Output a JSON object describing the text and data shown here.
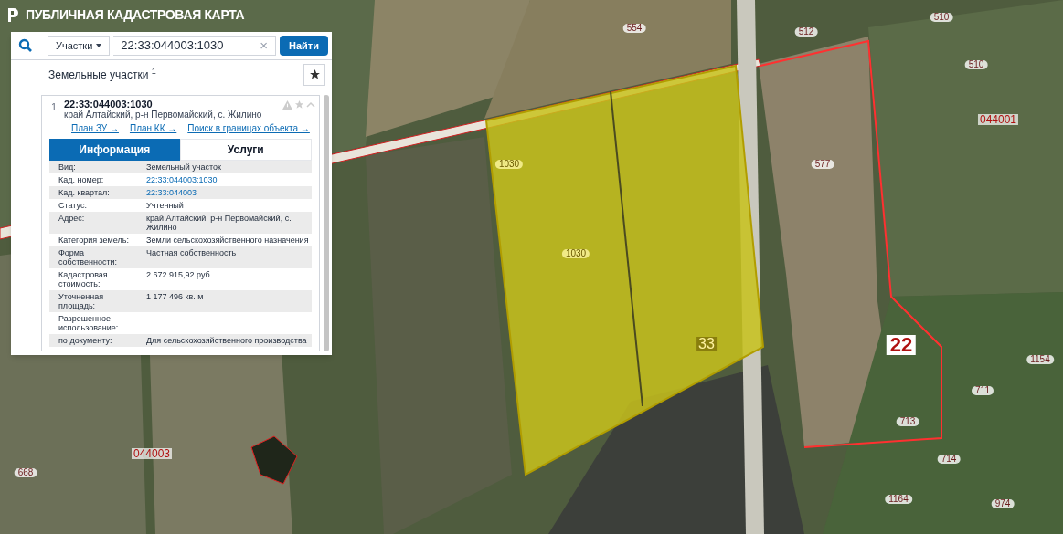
{
  "header": {
    "title": "ПУБЛИЧНАЯ КАДАСТРОВАЯ КАРТА"
  },
  "search": {
    "type_select": "Участки",
    "value": "22:33:044003:1030",
    "clear": "×",
    "button": "Найти"
  },
  "results": {
    "title": "Земельные участки $^{1}$",
    "items": [
      {
        "index": "1.",
        "number": "22:33:044003:1030",
        "address": "край Алтайский, р-н Первомайский, с. Жилино",
        "expanded": true,
        "links": [
          "План ЗУ →",
          "План КК →",
          "Поиск в границах объекта →"
        ],
        "tabs": [
          {
            "label": "Информация",
            "selected": true
          },
          {
            "label": "Услуги",
            "selected": false
          }
        ],
        "fields": [
          {
            "label": "Вид:",
            "value": "Земельный участок",
            "kind": "text"
          },
          {
            "label": "Кад. номер:",
            "value": "22:33:044003:1030",
            "kind": "link"
          },
          {
            "label": "Кад. квартал:",
            "value": "22:33:044003",
            "kind": "link"
          },
          {
            "label": "Статус:",
            "value": "Учтенный",
            "kind": "text"
          },
          {
            "label": "Адрес:",
            "value": "край Алтайский, р-н Первомайский, с. Жилино",
            "kind": "text"
          },
          {
            "label": "Категория земель:",
            "value": "Земли сельскохозяйственного назначения",
            "kind": "text"
          },
          {
            "label": "Форма собственности:",
            "value": "Частная собственность",
            "kind": "text"
          },
          {
            "label": "Кадастровая стоимость:",
            "value": "2 672 915,92 руб.",
            "kind": "text"
          },
          {
            "label": "Уточненная площадь:",
            "value": "1 177 496 кв. м",
            "kind": "text"
          },
          {
            "label": "Разрешенное использование:",
            "value": "-",
            "kind": "text"
          },
          {
            "label": "по документу:",
            "value": "Для сельскохозяйственного производства",
            "kind": "text"
          }
        ]
      }
    ]
  },
  "map_labels": [
    {
      "text": "554",
      "kind": "parcel"
    },
    {
      "text": "512",
      "kind": "parcel"
    },
    {
      "text": "510",
      "kind": "parcel"
    },
    {
      "text": "510",
      "kind": "parcel"
    },
    {
      "text": "044001",
      "kind": "quarter"
    },
    {
      "text": "577",
      "kind": "parcel"
    },
    {
      "text": "1030",
      "kind": "selected"
    },
    {
      "text": "1030",
      "kind": "selected"
    },
    {
      "text": "33",
      "kind": "block"
    },
    {
      "text": "22",
      "kind": "district"
    },
    {
      "text": "1154",
      "kind": "parcel"
    },
    {
      "text": "711",
      "kind": "parcel"
    },
    {
      "text": "713",
      "kind": "parcel"
    },
    {
      "text": "714",
      "kind": "parcel"
    },
    {
      "text": "044003",
      "kind": "quarter"
    },
    {
      "text": "668",
      "kind": "parcel"
    },
    {
      "text": "1164",
      "kind": "parcel"
    },
    {
      "text": "974",
      "kind": "parcel"
    }
  ]
}
